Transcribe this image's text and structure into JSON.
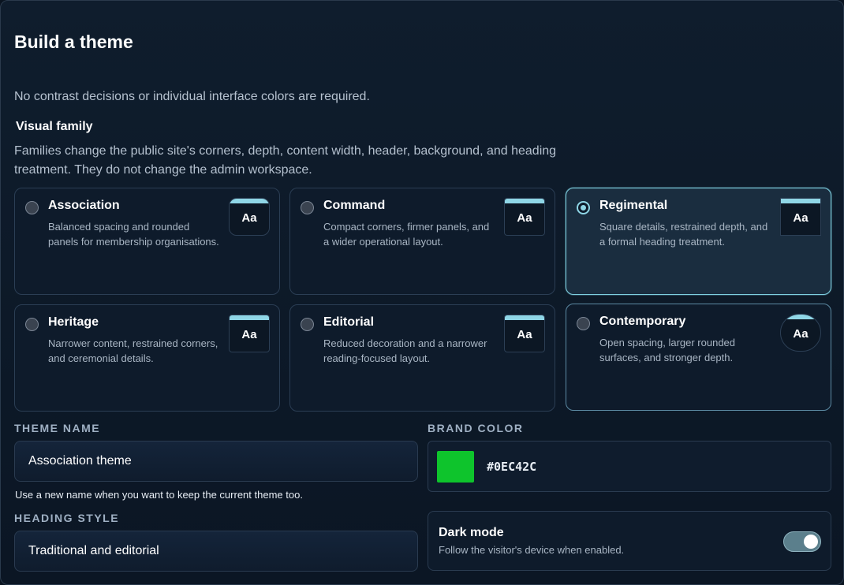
{
  "title": "Build a theme",
  "intro": "No contrast decisions or individual interface colors are required.",
  "visual_family": {
    "label": "Visual family",
    "description": "Families change the public site's corners, depth, content width, header, background, and heading treatment. They do not change the admin workspace.",
    "preview_text": "Aa",
    "selected": "Regimental",
    "cards": [
      {
        "name": "Association",
        "description": "Balanced spacing and rounded panels for membership organisations."
      },
      {
        "name": "Command",
        "description": "Compact corners, firmer panels, and a wider operational layout."
      },
      {
        "name": "Regimental",
        "description": "Square details, restrained depth, and a formal heading treatment."
      },
      {
        "name": "Heritage",
        "description": "Narrower content, restrained corners, and ceremonial details."
      },
      {
        "name": "Editorial",
        "description": "Reduced decoration and a narrower reading-focused layout."
      },
      {
        "name": "Contemporary",
        "description": "Open spacing, larger rounded surfaces, and stronger depth."
      }
    ]
  },
  "theme_name": {
    "label": "THEME NAME",
    "value": "Association theme",
    "hint": "Use a new name when you want to keep the current theme too."
  },
  "brand_color": {
    "label": "BRAND COLOR",
    "value": "#0EC42C",
    "swatch": "#0ec42c"
  },
  "heading_style": {
    "label": "HEADING STYLE",
    "value": "Traditional and editorial"
  },
  "dark_mode": {
    "title": "Dark mode",
    "description": "Follow the visitor's device when enabled.",
    "enabled": true
  },
  "colors": {
    "accent": "#8fd6e6",
    "background": "#0b1624"
  }
}
